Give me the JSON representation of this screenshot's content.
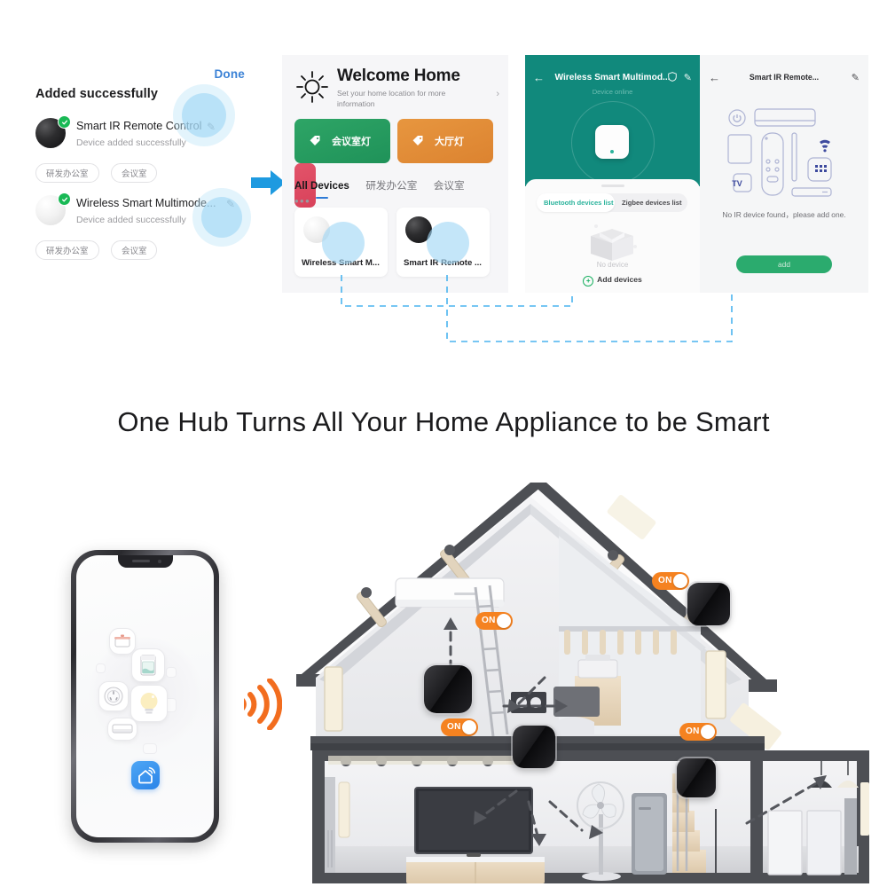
{
  "headline": "One Hub Turns All Your Home Appliance to be Smart",
  "panel_added": {
    "done_label": "Done",
    "title": "Added successfully",
    "devices": [
      {
        "name": "Smart IR Remote Control",
        "status": "Device added successfully",
        "edit_icon": "pencil-icon",
        "check_icon": "check-circle-icon",
        "tags": [
          "研发办公室",
          "会议室"
        ]
      },
      {
        "name": "Wireless Smart Multimode...",
        "status": "Device added successfully",
        "edit_icon": "pencil-icon",
        "check_icon": "check-circle-icon",
        "tags": [
          "研发办公室",
          "会议室"
        ]
      }
    ],
    "arrow_icon": "arrow-right-icon",
    "arrow_color": "#1e9ae0"
  },
  "panel_home": {
    "sun_icon": "sun-icon",
    "title": "Welcome Home",
    "subtitle": "Set your home location for more information",
    "chevron_icon": "chevron-right-icon",
    "scenes": [
      {
        "label": "会议室灯",
        "color": "#20915a",
        "icon": "tag-icon"
      },
      {
        "label": "大厅灯",
        "color": "#dc8330",
        "icon": "tag-icon"
      },
      {
        "label": "",
        "color": "#d8415a",
        "icon": "tag-icon"
      }
    ],
    "tabs": [
      {
        "label": "All Devices",
        "active": true
      },
      {
        "label": "研发办公室",
        "active": false
      },
      {
        "label": "会议室",
        "active": false
      },
      {
        "label": "•••",
        "active": false
      }
    ],
    "cards": [
      {
        "label": "Wireless Smart M...",
        "icon": "white-hub-icon"
      },
      {
        "label": "Smart IR Remote ...",
        "icon": "black-hub-icon"
      }
    ]
  },
  "panel_multimode": {
    "back_icon": "arrow-left-icon",
    "title": "Wireless Smart Multimod...",
    "shield_icon": "shield-icon",
    "edit_icon": "pencil-icon",
    "status": "Device online",
    "header_color": "#11897c",
    "segments": [
      {
        "label": "Bluetooth devices list",
        "active": true
      },
      {
        "label": "Zigbee devices list",
        "active": false
      }
    ],
    "empty_icon": "empty-box-icon",
    "empty_label": "No device",
    "add_label": "Add devices",
    "add_icon": "plus-circle-icon"
  },
  "panel_ir": {
    "back_icon": "arrow-left-icon",
    "title": "Smart IR Remote...",
    "edit_icon": "pencil-icon",
    "art_icons": [
      "power-button-icon",
      "air-conditioner-icon",
      "tv-screen-icon",
      "remote-control-icon",
      "light-strip-icon",
      "wifi-icon",
      "smart-socket-icon",
      "tv-label-icon",
      "set-top-box-icon"
    ],
    "tv_label": "TV",
    "message": "No IR device found，please add one.",
    "add_button": "add",
    "add_button_color": "#2bab6e"
  },
  "bottom_scene": {
    "wifi_icon": "wifi-signal-icon",
    "wifi_color": "#f26d1f",
    "phone": {
      "app_icon": "smart-home-app-icon",
      "tiles": [
        "rice-cooker-icon",
        "washing-machine-icon",
        "socket-icon",
        "light-bulb-icon",
        "air-conditioner-icon"
      ]
    },
    "house": {
      "toggles": [
        {
          "label": "ON",
          "color": "#f58220"
        },
        {
          "label": "ON",
          "color": "#f58220"
        },
        {
          "label": "ON",
          "color": "#f58220"
        },
        {
          "label": "ON",
          "color": "#f58220"
        }
      ],
      "hubs": 4,
      "appliances": [
        "air-conditioner-icon",
        "printer-icon",
        "desktop-monitor-icon",
        "television-icon",
        "stand-fan-icon",
        "refrigerator-icon",
        "pendant-lamp-icon"
      ]
    }
  }
}
